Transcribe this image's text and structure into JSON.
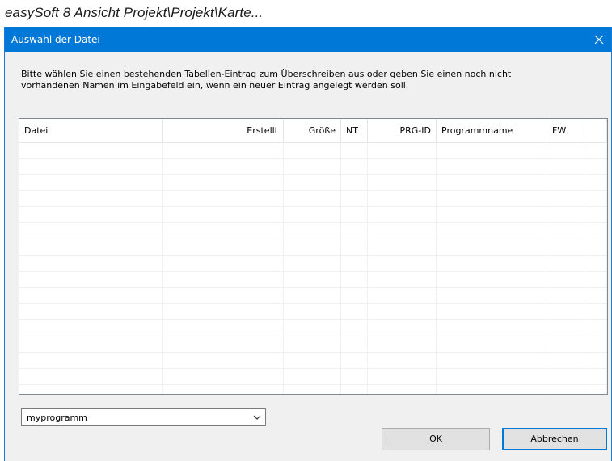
{
  "document": {
    "heading": "easySoft 8 Ansicht Projekt\\Projekt\\Karte..."
  },
  "dialog": {
    "title": "Auswahl der Datei",
    "close_icon": "close-icon",
    "instruction": "Bitte wählen Sie einen bestehenden Tabellen-Eintrag zum Überschreiben aus oder geben Sie einen noch nicht\nvorhandenen Namen im Eingabefeld ein, wenn ein neuer Eintrag angelegt werden soll.",
    "table": {
      "columns": [
        {
          "key": "datei",
          "label": "Datei",
          "align": "left"
        },
        {
          "key": "erstellt",
          "label": "Erstellt",
          "align": "right"
        },
        {
          "key": "groesse",
          "label": "Größe",
          "align": "right"
        },
        {
          "key": "nt",
          "label": "NT",
          "align": "left"
        },
        {
          "key": "prg_id",
          "label": "PRG-ID",
          "align": "right"
        },
        {
          "key": "programmname",
          "label": "Programmname",
          "align": "left"
        },
        {
          "key": "fw",
          "label": "FW",
          "align": "left"
        },
        {
          "key": "extra",
          "label": "",
          "align": "left"
        }
      ],
      "rows": []
    },
    "filename_combo": {
      "value": "myprogramm",
      "dropdown_icon": "chevron-down-icon"
    },
    "buttons": {
      "ok_label": "OK",
      "cancel_label": "Abbrechen"
    },
    "colors": {
      "titlebar": "#0078d7",
      "dialog_bg": "#f0f0f0",
      "default_button_border": "#0078d7"
    }
  }
}
